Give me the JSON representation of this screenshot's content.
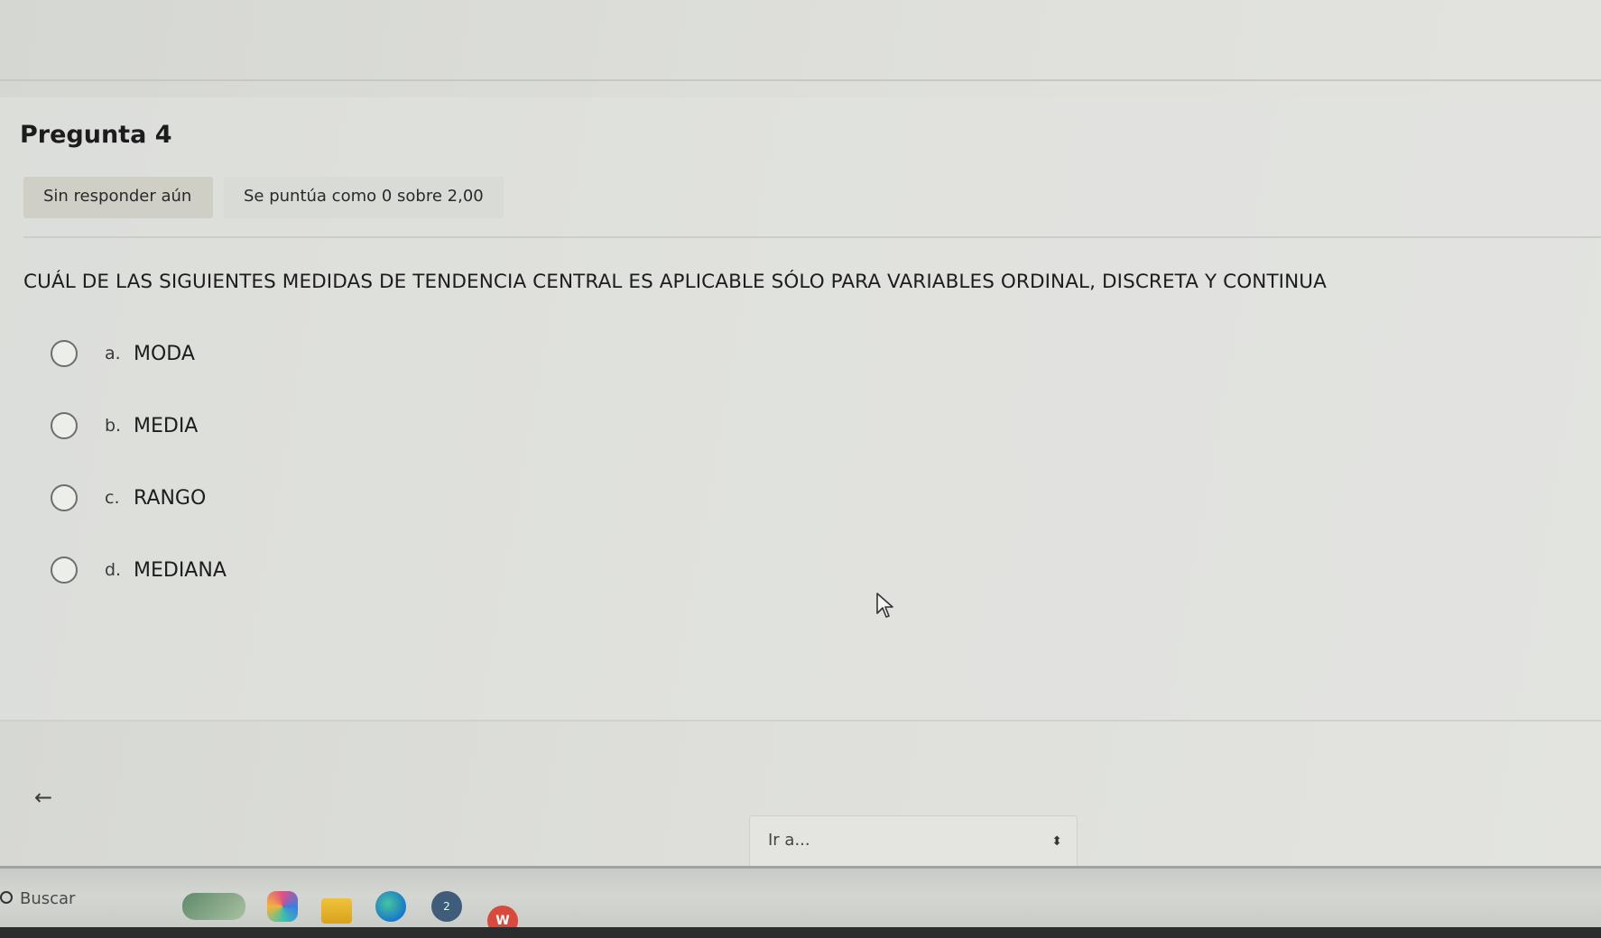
{
  "question": {
    "title": "Pregunta 4",
    "status": "Sin responder aún",
    "grade": "Se puntúa como 0 sobre 2,00",
    "text": "CUÁL DE LAS SIGUIENTES MEDIDAS DE TENDENCIA CENTRAL ES APLICABLE SÓLO PARA VARIABLES ORDINAL, DISCRETA Y CONTINUA",
    "answers": [
      {
        "letter": "a.",
        "text": "MODA",
        "selected": false
      },
      {
        "letter": "b.",
        "text": "MEDIA",
        "selected": false
      },
      {
        "letter": "c.",
        "text": "RANGO",
        "selected": false
      },
      {
        "letter": "d.",
        "text": "MEDIANA",
        "selected": false
      }
    ]
  },
  "navigation": {
    "back_icon": "arrow-left-icon",
    "back_glyph": "←",
    "jump_placeholder": "Ir a...",
    "jump_arrows": "⬍"
  },
  "taskbar": {
    "search_label": "Buscar",
    "clock_glyph": "2",
    "wps_glyph": "W",
    "icons": [
      "widgets-icon",
      "copilot-icon",
      "file-explorer-icon",
      "edge-icon",
      "clock-icon",
      "wps-office-icon"
    ]
  }
}
